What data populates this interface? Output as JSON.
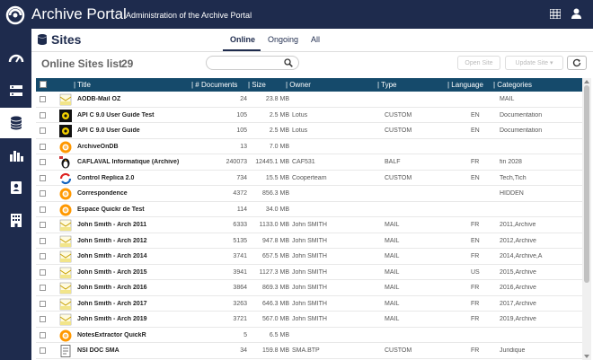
{
  "app": {
    "title": "Archive Portal",
    "subtitle": "Administration of the Archive Portal"
  },
  "header": {
    "title": "Sites",
    "tabs": [
      "Online",
      "Ongoing",
      "All"
    ]
  },
  "toolbar": {
    "list_title": "Online Sites list",
    "count": "29",
    "search_value": "",
    "open_site": "Open Site",
    "update_site": "Update Site ▾"
  },
  "table": {
    "columns": [
      "| Title",
      "| # Documents",
      "| Size",
      "| Owner",
      "| Type",
      "| Language",
      "| Categories"
    ],
    "rows": [
      {
        "icon": "mail-doc",
        "title": "AODB-Mail OZ",
        "docs": "24",
        "size": "23.8 MB",
        "owner": "",
        "type": "",
        "lang": "",
        "cat": "MAIL"
      },
      {
        "icon": "gear",
        "title": "API C 9.0 User Guide Test",
        "docs": "105",
        "size": "2.5 MB",
        "owner": "Lotus",
        "type": "CUSTOM",
        "lang": "EN",
        "cat": "Documentation"
      },
      {
        "icon": "gear",
        "title": "API C 9.0 User Guide",
        "docs": "105",
        "size": "2.5 MB",
        "owner": "Lotus",
        "type": "CUSTOM",
        "lang": "EN",
        "cat": "Documentation"
      },
      {
        "icon": "orange-circle",
        "title": "ArchiveOnDB",
        "docs": "13",
        "size": "7.0 MB",
        "owner": "",
        "type": "",
        "lang": "",
        "cat": ""
      },
      {
        "icon": "penguin",
        "title": "CAFLAVAL Informatique (Archive)",
        "docs": "240073",
        "size": "12445.1 MB",
        "owner": "CAF531",
        "type": "BALF",
        "lang": "FR",
        "cat": "fin 2028"
      },
      {
        "icon": "replica",
        "title": "Control Replica 2.0",
        "docs": "734",
        "size": "15.5 MB",
        "owner": "Cooperteam",
        "type": "CUSTOM",
        "lang": "EN",
        "cat": "Tech,Tich"
      },
      {
        "icon": "orange-circle",
        "title": "Correspondence",
        "docs": "4372",
        "size": "856.3 MB",
        "owner": "",
        "type": "",
        "lang": "",
        "cat": "HIDDEN"
      },
      {
        "icon": "orange-circle",
        "title": "Espace Quickr de Test",
        "docs": "114",
        "size": "34.0 MB",
        "owner": "",
        "type": "",
        "lang": "",
        "cat": ""
      },
      {
        "icon": "mail-doc",
        "title": "John Smith - Arch 2011",
        "docs": "6333",
        "size": "1133.0 MB",
        "owner": "John SMITH",
        "type": "MAIL",
        "lang": "FR",
        "cat": "2011,Archive"
      },
      {
        "icon": "mail-doc",
        "title": "John Smith - Arch 2012",
        "docs": "5135",
        "size": "947.8 MB",
        "owner": "John SMITH",
        "type": "MAIL",
        "lang": "EN",
        "cat": "2012,Archive"
      },
      {
        "icon": "mail-doc",
        "title": "John Smith - Arch 2014",
        "docs": "3741",
        "size": "657.5 MB",
        "owner": "John SMITH",
        "type": "MAIL",
        "lang": "FR",
        "cat": "2014,Archive,A"
      },
      {
        "icon": "mail-doc",
        "title": "John Smith - Arch 2015",
        "docs": "3941",
        "size": "1127.3 MB",
        "owner": "John SMITH",
        "type": "MAIL",
        "lang": "US",
        "cat": "2015,Archive"
      },
      {
        "icon": "mail-doc",
        "title": "John Smith - Arch 2016",
        "docs": "3864",
        "size": "869.3 MB",
        "owner": "John SMITH",
        "type": "MAIL",
        "lang": "FR",
        "cat": "2016,Archive"
      },
      {
        "icon": "mail-doc",
        "title": "John Smith - Arch 2017",
        "docs": "3263",
        "size": "646.3 MB",
        "owner": "John SMITH",
        "type": "MAIL",
        "lang": "FR",
        "cat": "2017,Archive"
      },
      {
        "icon": "mail-doc",
        "title": "John Smith - Arch 2019",
        "docs": "3721",
        "size": "567.0 MB",
        "owner": "John SMITH",
        "type": "MAIL",
        "lang": "FR",
        "cat": "2019,Archive"
      },
      {
        "icon": "orange-circle",
        "title": "NotesExtractor QuickR",
        "docs": "5",
        "size": "6.5 MB",
        "owner": "",
        "type": "",
        "lang": "",
        "cat": ""
      },
      {
        "icon": "doc",
        "title": "NSI DOC SMA",
        "docs": "34",
        "size": "159.8 MB",
        "owner": "SMA.BTP",
        "type": "CUSTOM",
        "lang": "FR",
        "cat": "Juridique"
      }
    ]
  },
  "sidebar": {
    "items": [
      {
        "icon": "dashboard-icon"
      },
      {
        "icon": "servers-icon"
      },
      {
        "icon": "database-icon"
      },
      {
        "icon": "chart-icon"
      },
      {
        "icon": "contacts-icon"
      },
      {
        "icon": "building-icon"
      }
    ]
  },
  "colors": {
    "nav": "#1e2b4d",
    "table_header": "#154a6b",
    "accent": "#ff9800"
  }
}
